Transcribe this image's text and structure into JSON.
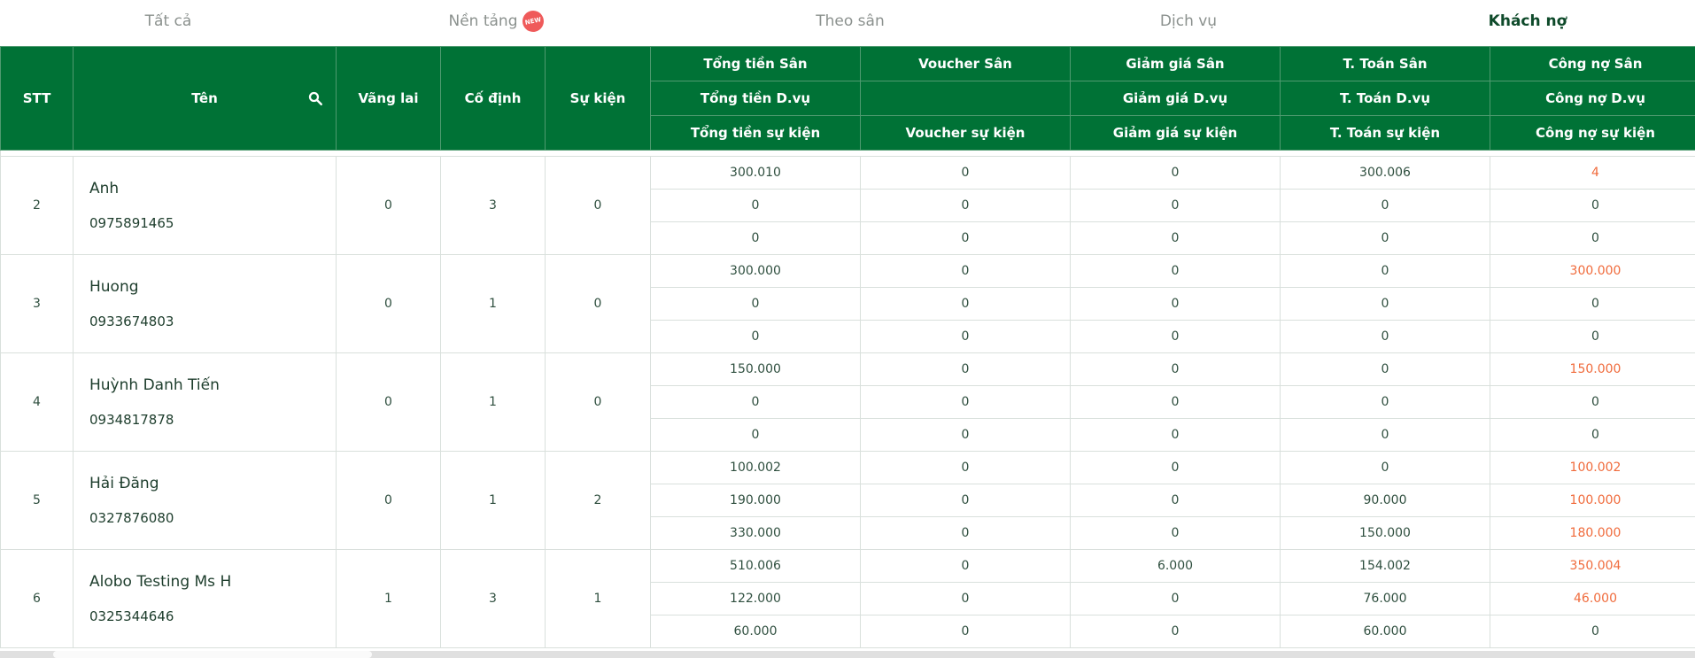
{
  "tabs": [
    {
      "label": "Tất cả",
      "active": false
    },
    {
      "label": "Nền tảng",
      "active": false,
      "badge": "NEW"
    },
    {
      "label": "Theo sân",
      "active": false
    },
    {
      "label": "Dịch vụ",
      "active": false
    },
    {
      "label": "Khách nợ",
      "active": true
    }
  ],
  "header": {
    "stt": "STT",
    "name": "Tên",
    "vang_lai": "Vãng lai",
    "co_dinh": "Cố định",
    "su_kien": "Sự kiện",
    "rows": [
      [
        "Tổng tiền Sân",
        "Voucher Sân",
        "Giảm giá Sân",
        "T. Toán Sân",
        "Công nợ Sân"
      ],
      [
        "Tổng tiền D.vụ",
        "",
        "Giảm giá D.vụ",
        "T. Toán D.vụ",
        "Công nợ D.vụ"
      ],
      [
        "Tổng tiền sự kiện",
        "Voucher sự kiện",
        "Giảm giá sự kiện",
        "T. Toán sự kiện",
        "Công nợ sự kiện"
      ]
    ]
  },
  "customers": [
    {
      "stt": "2",
      "name": "Anh",
      "phone": "0975891465",
      "vang_lai": "0",
      "co_dinh": "3",
      "su_kien": "0",
      "rows": [
        [
          "300.010",
          "0",
          "0",
          "300.006",
          "4"
        ],
        [
          "0",
          "0",
          "0",
          "0",
          "0"
        ],
        [
          "0",
          "0",
          "0",
          "0",
          "0"
        ]
      ]
    },
    {
      "stt": "3",
      "name": "Huong",
      "phone": "0933674803",
      "vang_lai": "0",
      "co_dinh": "1",
      "su_kien": "0",
      "rows": [
        [
          "300.000",
          "0",
          "0",
          "0",
          "300.000"
        ],
        [
          "0",
          "0",
          "0",
          "0",
          "0"
        ],
        [
          "0",
          "0",
          "0",
          "0",
          "0"
        ]
      ]
    },
    {
      "stt": "4",
      "name": "Huỳnh Danh Tiến",
      "phone": "0934817878",
      "vang_lai": "0",
      "co_dinh": "1",
      "su_kien": "0",
      "rows": [
        [
          "150.000",
          "0",
          "0",
          "0",
          "150.000"
        ],
        [
          "0",
          "0",
          "0",
          "0",
          "0"
        ],
        [
          "0",
          "0",
          "0",
          "0",
          "0"
        ]
      ]
    },
    {
      "stt": "5",
      "name": "Hải Đăng",
      "phone": "0327876080",
      "vang_lai": "0",
      "co_dinh": "1",
      "su_kien": "2",
      "rows": [
        [
          "100.002",
          "0",
          "0",
          "0",
          "100.002"
        ],
        [
          "190.000",
          "0",
          "0",
          "90.000",
          "100.000"
        ],
        [
          "330.000",
          "0",
          "0",
          "150.000",
          "180.000"
        ]
      ]
    },
    {
      "stt": "6",
      "name": "Alobo Testing Ms H",
      "phone": "0325344646",
      "vang_lai": "1",
      "co_dinh": "3",
      "su_kien": "1",
      "rows": [
        [
          "510.006",
          "0",
          "6.000",
          "154.002",
          "350.004"
        ],
        [
          "122.000",
          "0",
          "0",
          "76.000",
          "46.000"
        ],
        [
          "60.000",
          "0",
          "0",
          "60.000",
          "0"
        ]
      ]
    }
  ],
  "colors": {
    "header_bg": "#007236",
    "debt_positive": "#f06b3c",
    "active_tab": "#0e4a2a"
  },
  "icons": {
    "search": "search-icon"
  }
}
